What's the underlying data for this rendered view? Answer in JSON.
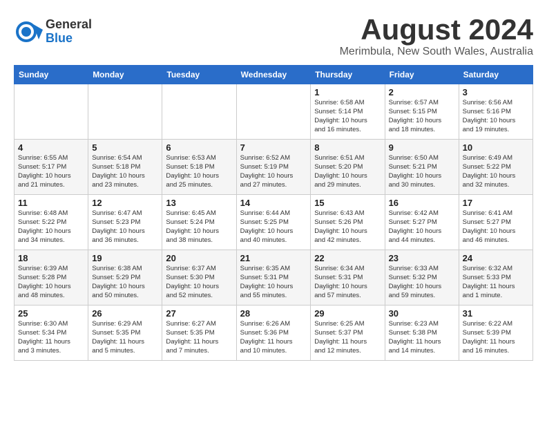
{
  "logo": {
    "line1": "General",
    "line2": "Blue"
  },
  "title": "August 2024",
  "subtitle": "Merimbula, New South Wales, Australia",
  "headers": [
    "Sunday",
    "Monday",
    "Tuesday",
    "Wednesday",
    "Thursday",
    "Friday",
    "Saturday"
  ],
  "weeks": [
    [
      {
        "day": "",
        "info": ""
      },
      {
        "day": "",
        "info": ""
      },
      {
        "day": "",
        "info": ""
      },
      {
        "day": "",
        "info": ""
      },
      {
        "day": "1",
        "info": "Sunrise: 6:58 AM\nSunset: 5:14 PM\nDaylight: 10 hours\nand 16 minutes."
      },
      {
        "day": "2",
        "info": "Sunrise: 6:57 AM\nSunset: 5:15 PM\nDaylight: 10 hours\nand 18 minutes."
      },
      {
        "day": "3",
        "info": "Sunrise: 6:56 AM\nSunset: 5:16 PM\nDaylight: 10 hours\nand 19 minutes."
      }
    ],
    [
      {
        "day": "4",
        "info": "Sunrise: 6:55 AM\nSunset: 5:17 PM\nDaylight: 10 hours\nand 21 minutes."
      },
      {
        "day": "5",
        "info": "Sunrise: 6:54 AM\nSunset: 5:18 PM\nDaylight: 10 hours\nand 23 minutes."
      },
      {
        "day": "6",
        "info": "Sunrise: 6:53 AM\nSunset: 5:18 PM\nDaylight: 10 hours\nand 25 minutes."
      },
      {
        "day": "7",
        "info": "Sunrise: 6:52 AM\nSunset: 5:19 PM\nDaylight: 10 hours\nand 27 minutes."
      },
      {
        "day": "8",
        "info": "Sunrise: 6:51 AM\nSunset: 5:20 PM\nDaylight: 10 hours\nand 29 minutes."
      },
      {
        "day": "9",
        "info": "Sunrise: 6:50 AM\nSunset: 5:21 PM\nDaylight: 10 hours\nand 30 minutes."
      },
      {
        "day": "10",
        "info": "Sunrise: 6:49 AM\nSunset: 5:22 PM\nDaylight: 10 hours\nand 32 minutes."
      }
    ],
    [
      {
        "day": "11",
        "info": "Sunrise: 6:48 AM\nSunset: 5:22 PM\nDaylight: 10 hours\nand 34 minutes."
      },
      {
        "day": "12",
        "info": "Sunrise: 6:47 AM\nSunset: 5:23 PM\nDaylight: 10 hours\nand 36 minutes."
      },
      {
        "day": "13",
        "info": "Sunrise: 6:45 AM\nSunset: 5:24 PM\nDaylight: 10 hours\nand 38 minutes."
      },
      {
        "day": "14",
        "info": "Sunrise: 6:44 AM\nSunset: 5:25 PM\nDaylight: 10 hours\nand 40 minutes."
      },
      {
        "day": "15",
        "info": "Sunrise: 6:43 AM\nSunset: 5:26 PM\nDaylight: 10 hours\nand 42 minutes."
      },
      {
        "day": "16",
        "info": "Sunrise: 6:42 AM\nSunset: 5:27 PM\nDaylight: 10 hours\nand 44 minutes."
      },
      {
        "day": "17",
        "info": "Sunrise: 6:41 AM\nSunset: 5:27 PM\nDaylight: 10 hours\nand 46 minutes."
      }
    ],
    [
      {
        "day": "18",
        "info": "Sunrise: 6:39 AM\nSunset: 5:28 PM\nDaylight: 10 hours\nand 48 minutes."
      },
      {
        "day": "19",
        "info": "Sunrise: 6:38 AM\nSunset: 5:29 PM\nDaylight: 10 hours\nand 50 minutes."
      },
      {
        "day": "20",
        "info": "Sunrise: 6:37 AM\nSunset: 5:30 PM\nDaylight: 10 hours\nand 52 minutes."
      },
      {
        "day": "21",
        "info": "Sunrise: 6:35 AM\nSunset: 5:31 PM\nDaylight: 10 hours\nand 55 minutes."
      },
      {
        "day": "22",
        "info": "Sunrise: 6:34 AM\nSunset: 5:31 PM\nDaylight: 10 hours\nand 57 minutes."
      },
      {
        "day": "23",
        "info": "Sunrise: 6:33 AM\nSunset: 5:32 PM\nDaylight: 10 hours\nand 59 minutes."
      },
      {
        "day": "24",
        "info": "Sunrise: 6:32 AM\nSunset: 5:33 PM\nDaylight: 11 hours\nand 1 minute."
      }
    ],
    [
      {
        "day": "25",
        "info": "Sunrise: 6:30 AM\nSunset: 5:34 PM\nDaylight: 11 hours\nand 3 minutes."
      },
      {
        "day": "26",
        "info": "Sunrise: 6:29 AM\nSunset: 5:35 PM\nDaylight: 11 hours\nand 5 minutes."
      },
      {
        "day": "27",
        "info": "Sunrise: 6:27 AM\nSunset: 5:35 PM\nDaylight: 11 hours\nand 7 minutes."
      },
      {
        "day": "28",
        "info": "Sunrise: 6:26 AM\nSunset: 5:36 PM\nDaylight: 11 hours\nand 10 minutes."
      },
      {
        "day": "29",
        "info": "Sunrise: 6:25 AM\nSunset: 5:37 PM\nDaylight: 11 hours\nand 12 minutes."
      },
      {
        "day": "30",
        "info": "Sunrise: 6:23 AM\nSunset: 5:38 PM\nDaylight: 11 hours\nand 14 minutes."
      },
      {
        "day": "31",
        "info": "Sunrise: 6:22 AM\nSunset: 5:39 PM\nDaylight: 11 hours\nand 16 minutes."
      }
    ]
  ]
}
